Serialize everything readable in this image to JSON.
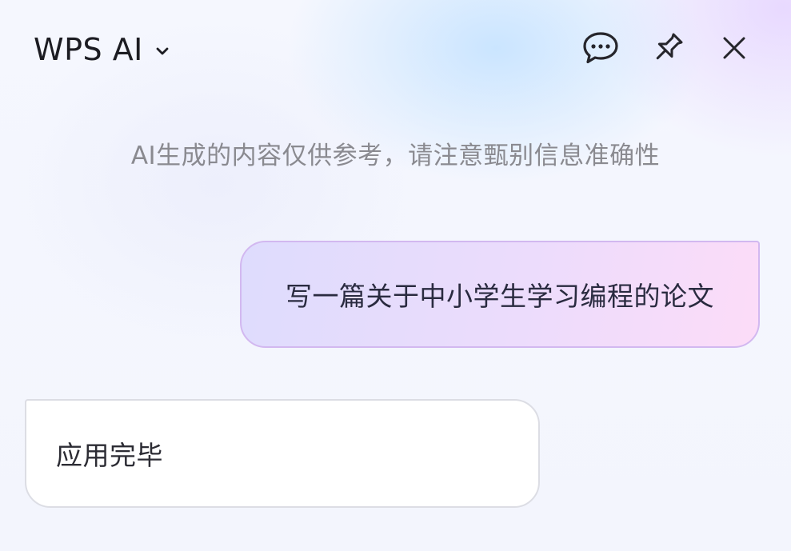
{
  "header": {
    "title": "WPS AI",
    "title_dropdown_icon": "chevron-down-icon",
    "actions": [
      {
        "name": "chat-bubble-icon"
      },
      {
        "name": "pin-icon"
      },
      {
        "name": "close-icon"
      }
    ]
  },
  "notice": "AI生成的内容仅供参考，请注意甄别信息准确性",
  "messages": {
    "user": "写一篇关于中小学生学习编程的论文",
    "assistant": "应用完毕"
  },
  "colors": {
    "text_primary": "#1c1c22",
    "notice_text": "#8a8a90",
    "user_bubble_border": "#d2b8f0",
    "user_bubble_gradient_start": "#dedcfd",
    "user_bubble_gradient_end": "#fcdcf8",
    "assistant_bubble_bg": "#ffffff"
  }
}
